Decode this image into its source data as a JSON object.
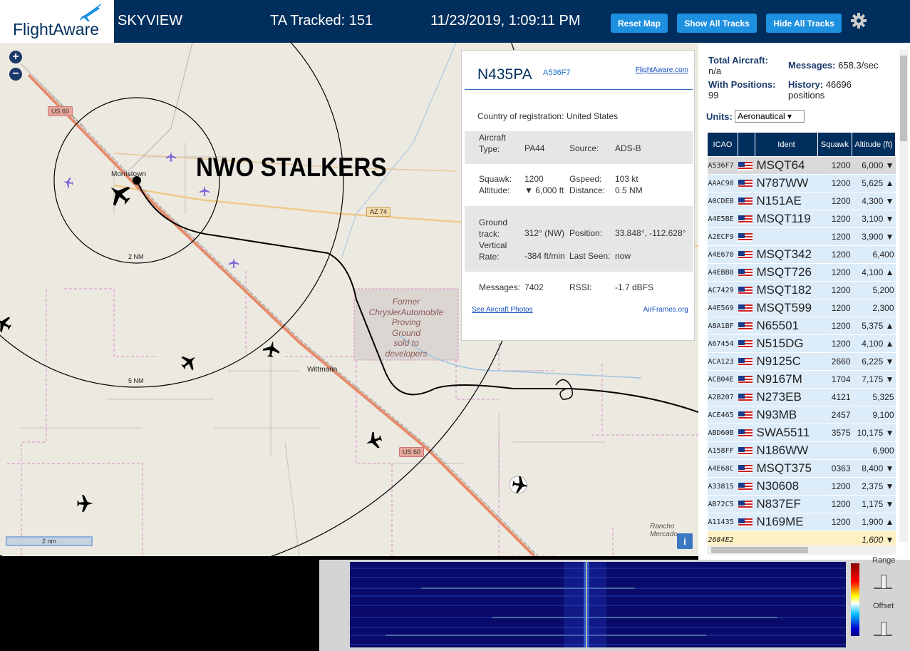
{
  "header": {
    "logo_text": "FlightAware",
    "app_name": "SKYVIEW",
    "tracked": "TA Tracked: 151",
    "datetime": "11/23/2019, 1:09:11 PM",
    "reset_map": "Reset Map",
    "show_all": "Show All Tracks",
    "hide_all": "Hide All Tracks",
    "settings_icon": "gear-icon"
  },
  "map": {
    "overlay_text": "NWO STALKERS",
    "place_morristown": "Morristown",
    "place_wittmann": "Wittmann",
    "place_rancho": "Rancho Mercado",
    "shield_us60_a": "US 60",
    "shield_az74": "AZ 74",
    "shield_us60_b": "US 60",
    "ring_2nm": "2 NM",
    "ring_5nm": "5 NM",
    "scale": "2 nm",
    "former_site": [
      "Former",
      "ChryslerAutomobile",
      "Proving",
      "Ground",
      "sold to",
      "developers"
    ],
    "info": "i"
  },
  "popup": {
    "registration": "N435PA",
    "hex": "A536F7",
    "fa_link": "FlightAware.com",
    "country_label": "Country of registration:",
    "country": "United States",
    "aircraft_type_label": "Aircraft Type:",
    "aircraft_type": "PA44",
    "source_label": "Source:",
    "source": "ADS-B",
    "squawk_label": "Squawk:",
    "squawk": "1200",
    "gspeed_label": "Gspeed:",
    "gspeed": "103 kt",
    "altitude_label": "Altitude:",
    "altitude": "▼ 6,000 ft",
    "distance_label": "Distance:",
    "distance": "0.5 NM",
    "ground_track_label": "Ground track:",
    "ground_track": "312° (NW)",
    "position_label": "Position:",
    "position": "33.848°, -112.628°",
    "vrate_label": "Vertical Rate:",
    "vrate": "-384 ft/min",
    "last_seen_label": "Last Seen:",
    "last_seen": "now",
    "messages_label": "Messages:",
    "messages": "7402",
    "rssi_label": "RSSI:",
    "rssi": "-1.7 dBFS",
    "photos_link": "See Aircraft Photos",
    "airframes_link": "AirFrames.org"
  },
  "sidebar": {
    "total_label": "Total Aircraft:",
    "total": "n/a",
    "messages_label": "Messages:",
    "messages": "658.3/sec",
    "positions_label": "With Positions:",
    "positions": "99",
    "history_label": "History:",
    "history": "46696 positions",
    "units_label": "Units:",
    "units_value": "Aeronautical",
    "columns": [
      "ICAO",
      "",
      "Ident",
      "Squawk",
      "Altitude (ft)"
    ],
    "rows": [
      [
        "A536F7",
        "MSQT64",
        "1200",
        "6,000 ▼"
      ],
      [
        "AAAC90",
        "N787WW",
        "1200",
        "5,625 ▲"
      ],
      [
        "A0CDEB",
        "N151AE",
        "1200",
        "4,300 ▼"
      ],
      [
        "A4E5BE",
        "MSQT119",
        "1200",
        "3,100 ▼"
      ],
      [
        "A2ECF9",
        "",
        "1200",
        "3,900 ▼"
      ],
      [
        "A4E670",
        "MSQT342",
        "1200",
        "6,400"
      ],
      [
        "A4EBB0",
        "MSQT726",
        "1200",
        "4,100 ▲"
      ],
      [
        "AC7429",
        "MSQT182",
        "1200",
        "5,200"
      ],
      [
        "A4E569",
        "MSQT599",
        "1200",
        "2,300"
      ],
      [
        "A8A1BF",
        "N65501",
        "1200",
        "5,375 ▲"
      ],
      [
        "A67454",
        "N515DG",
        "1200",
        "4,100 ▲"
      ],
      [
        "ACA123",
        "N9125C",
        "2660",
        "6,225 ▼"
      ],
      [
        "ACB04E",
        "N9167M",
        "1704",
        "7,175 ▼"
      ],
      [
        "A2B207",
        "N273EB",
        "4121",
        "5,325"
      ],
      [
        "ACE465",
        "N93MB",
        "2457",
        "9,100"
      ],
      [
        "ABD60B",
        "SWA5511",
        "3575",
        "10,175 ▼"
      ],
      [
        "A158FF",
        "N186WW",
        "",
        "6,900"
      ],
      [
        "A4E68C",
        "MSQT375",
        "0363",
        "8,400 ▼"
      ],
      [
        "A33815",
        "N30608",
        "1200",
        "2,375 ▼"
      ],
      [
        "AB72C5",
        "N837EF",
        "1200",
        "1,175 ▼"
      ],
      [
        "A11435",
        "N169ME",
        "1200",
        "1,900 ▲"
      ],
      [
        "2684E2",
        "",
        "",
        "1,600 ▼"
      ]
    ]
  },
  "spectrum": {
    "range_label": "Range",
    "offset_label": "Offset"
  }
}
